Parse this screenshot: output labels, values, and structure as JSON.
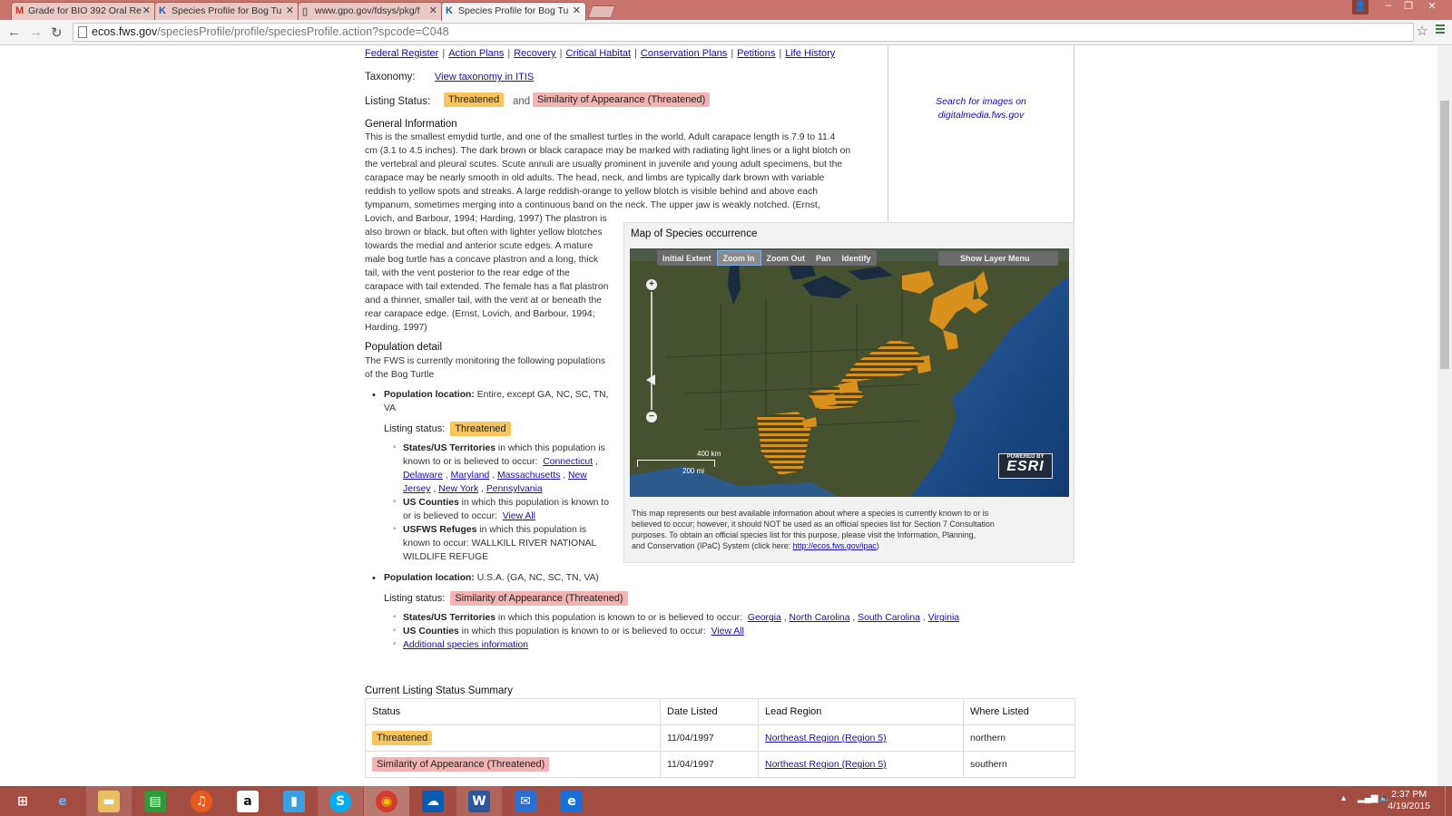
{
  "browser": {
    "tabs": [
      {
        "title": "Grade for BIO 392 Oral Re",
        "favicon": "gmail-icon"
      },
      {
        "title": "Species Profile for Bog Tu",
        "favicon": "fws-icon"
      },
      {
        "title": "www.gpo.gov/fdsys/pkg/f",
        "favicon": "page-icon"
      },
      {
        "title": "Species Profile for Bog Tu",
        "favicon": "fws-icon",
        "active": true
      }
    ],
    "url_domain": "ecos.fws.gov",
    "url_path": "/speciesProfile/profile/speciesProfile.action?spcode=C048"
  },
  "page": {
    "top_links": [
      "Federal Register",
      "Action Plans",
      "Recovery",
      "Critical Habitat",
      "Conservation Plans",
      "Petitions",
      "Life History"
    ],
    "taxonomy_label": "Taxonomy:",
    "taxonomy_link": "View taxonomy in ITIS",
    "listing_status_label": "Listing Status:",
    "status_threatened": "Threatened",
    "status_and": "and",
    "status_similarity": "Similarity of Appearance (Threatened)",
    "images_link": "Search for images on digitalmedia.fws.gov",
    "general_info_heading": "General Information",
    "general_info_lines": [
      "This is the smallest emydid turtle, and one of the smallest turtles in the world. Adult carapace length is 7.9 to 11.4",
      "cm (3.1 to 4.5 inches). The dark brown or black carapace may be marked with radiating light lines or a light blotch on",
      "the vertebral and pleural scutes. Scute annuli are usually prominent in juvenile and young adult specimens, but the",
      "carapace may be nearly smooth in old adults. The head, neck, and limbs are typically dark brown with variable",
      "reddish to yellow spots and streaks. A large reddish-orange to yellow blotch is visible behind and above each",
      "tympanum, sometimes merging into a continuous band on the neck. The upper jaw is weakly notched. (Ernst,",
      "Lovich, and Barbour, 1994; Harding, 1997) The plastron is",
      "also brown or black, but often with lighter yellow blotches",
      "towards the medial and anterior scute edges. A mature",
      "male bog turtle has a concave plastron and a long, thick",
      "tail, with the vent posterior to the rear edge of the",
      "carapace with tail extended. The female has a flat plastron",
      "and a thinner, smaller tail, with the vent at or beneath the",
      "rear carapace edge. (Ernst, Lovich, and Barbour, 1994;",
      "Harding, 1997)"
    ],
    "population_heading": "Population detail",
    "population_intro": [
      "The FWS is currently monitoring the following populations",
      "of the Bog Turtle"
    ],
    "pop1": {
      "location_label": "Population location:",
      "location_text": "Entire, except GA, NC, SC, TN,",
      "location_text2": "VA",
      "listing_label": "Listing status:",
      "listing_value": "Threatened",
      "states_label": "States/US Territories",
      "states_text": "in which this population is",
      "states_text2": "known to or is believed to occur:",
      "states": [
        "Connecticut",
        "Delaware",
        "Maryland",
        "Massachusetts",
        "New",
        "Jersey",
        "New York",
        "Pennsylvania"
      ],
      "counties_label": "US Counties",
      "counties_text": "in which this population is known to",
      "counties_text2": "or is believed to occur:",
      "counties_link": "View All",
      "refuges_label": "USFWS Refuges",
      "refuges_text": "in which this population is",
      "refuges_text2": "known to occur:  WALLKILL RIVER NATIONAL",
      "refuges_text3": "WILDLIFE REFUGE"
    },
    "pop2": {
      "location_label": "Population location:",
      "location_text": "U.S.A. (GA, NC, SC, TN, VA)",
      "listing_label": "Listing status:",
      "listing_value": "Similarity of Appearance (Threatened)",
      "states_label": "States/US Territories",
      "states_text": "in which this population is known to or is believed to occur:",
      "states": [
        "Georgia",
        "North Carolina",
        "South Carolina",
        "Virginia"
      ],
      "counties_label": "US Counties",
      "counties_text": "in which this population is known to or is believed to occur:",
      "counties_link": "View All",
      "additional_link": "Additional species information"
    },
    "map": {
      "title": "Map of Species occurrence",
      "tools": [
        "Initial Extent",
        "Zoom In",
        "Zoom Out",
        "Pan",
        "Identify"
      ],
      "active_tool": "Zoom In",
      "layer_menu": "Show Layer Menu",
      "scale_km": "400 km",
      "scale_mi": "200 mi",
      "esri_powered": "POWERED BY",
      "esri_name": "ESRI",
      "zoom_plus": "+",
      "zoom_minus": "−",
      "disclaimer_lines": [
        "This map represents our best available information about where a species is currently known to or is",
        "believed to occur; however, it should NOT be used as an official species list for Section 7 Consultation",
        "purposes. To obtain an official species list for this purpose, please visit the Information, Planning,",
        "and Conservation (IPaC) System (click here: "
      ],
      "disclaimer_link": "http://ecos.fws.gov/ipac",
      "disclaimer_end": ")",
      "colors": {
        "range": "#d9901c",
        "land": "#3e4a30",
        "water": "#1f4f8f"
      }
    },
    "summary": {
      "heading": "Current Listing Status Summary",
      "columns": [
        "Status",
        "Date Listed",
        "Lead Region",
        "Where Listed"
      ],
      "rows": [
        {
          "status": "Threatened",
          "date": "11/04/1997",
          "region": "Northeast Region (Region 5)",
          "where": "northern"
        },
        {
          "status": "Similarity of Appearance (Threatened)",
          "date": "11/04/1997",
          "region": "Northeast Region (Region 5)",
          "where": "southern"
        }
      ]
    }
  },
  "taskbar": {
    "apps": [
      "start-icon",
      "ie-icon",
      "file-explorer-icon",
      "store-icon",
      "music-icon",
      "amazon-icon",
      "reader-icon",
      "skype-icon",
      "chrome-icon",
      "onedrive-icon",
      "word-icon",
      "mail-icon",
      "ie-modern-icon"
    ],
    "time": "2:37 PM",
    "date": "4/19/2015"
  }
}
